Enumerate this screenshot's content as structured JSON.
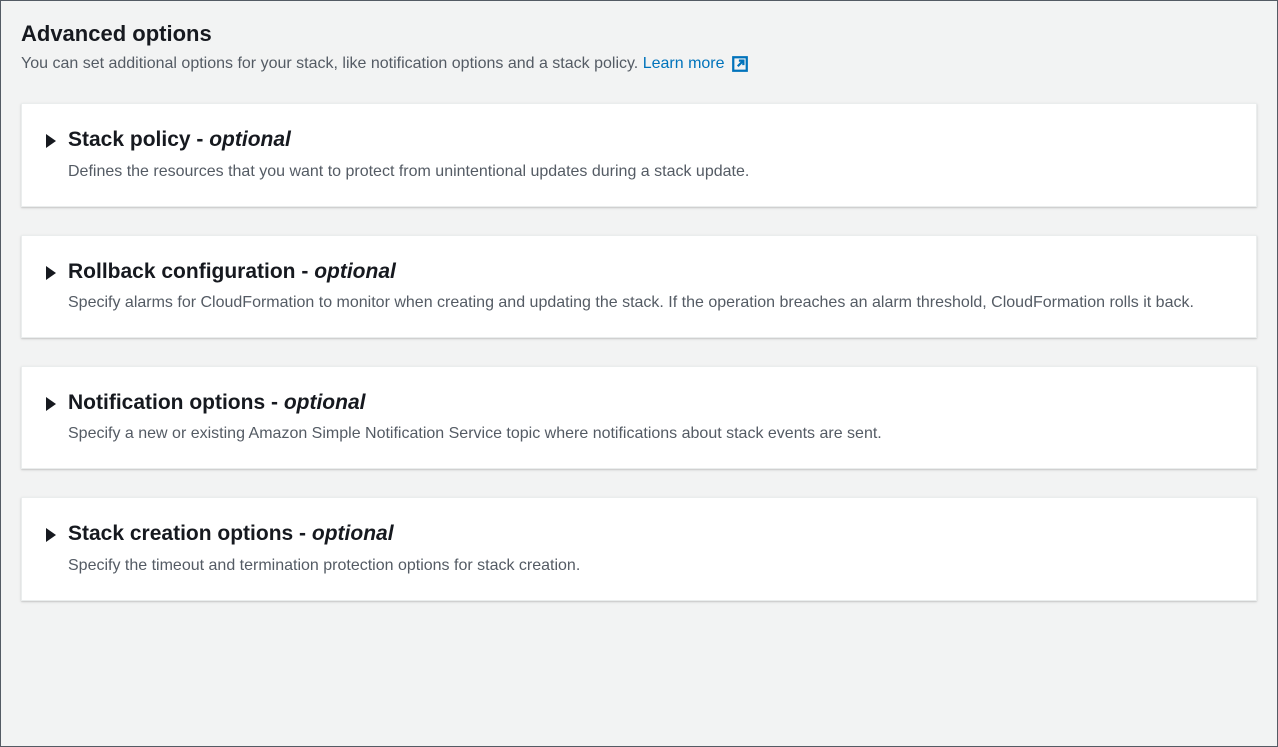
{
  "header": {
    "title": "Advanced options",
    "subtitle": "You can set additional options for your stack, like notification options and a stack policy.",
    "learn_more_label": "Learn more"
  },
  "sections": [
    {
      "title_prefix": "Stack policy - ",
      "title_optional": "optional",
      "description": "Defines the resources that you want to protect from unintentional updates during a stack update."
    },
    {
      "title_prefix": "Rollback configuration - ",
      "title_optional": "optional",
      "description": "Specify alarms for CloudFormation to monitor when creating and updating the stack. If the operation breaches an alarm threshold, CloudFormation rolls it back."
    },
    {
      "title_prefix": "Notification options - ",
      "title_optional": "optional",
      "description": "Specify a new or existing Amazon Simple Notification Service topic where notifications about stack events are sent."
    },
    {
      "title_prefix": "Stack creation options - ",
      "title_optional": "optional",
      "description": "Specify the timeout and termination protection options for stack creation."
    }
  ]
}
